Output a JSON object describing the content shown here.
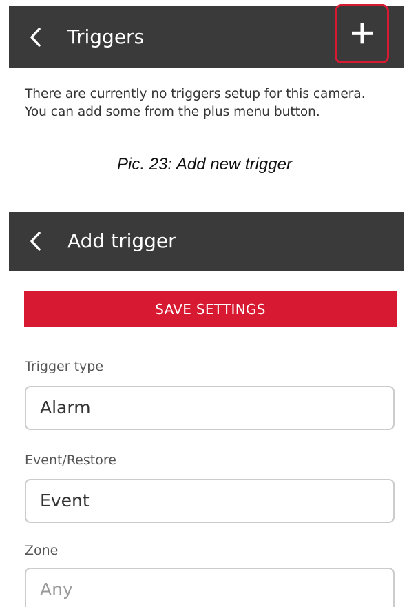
{
  "triggers_screen": {
    "title": "Triggers",
    "back_icon": "chevron-left-icon",
    "add_icon": "plus-icon",
    "highlight_color": "#d71a32",
    "empty_message_line1": "There are currently no triggers setup for this camera.",
    "empty_message_line2": "You can add some from the plus menu button."
  },
  "caption": "Pic. 23: Add new trigger",
  "add_trigger_screen": {
    "title": "Add trigger",
    "back_icon": "chevron-left-icon",
    "save_label": "SAVE SETTINGS",
    "fields": [
      {
        "label": "Trigger type",
        "value": "Alarm",
        "placeholder": ""
      },
      {
        "label": "Event/Restore",
        "value": "Event",
        "placeholder": ""
      },
      {
        "label": "Zone",
        "value": "",
        "placeholder": "Any"
      }
    ]
  },
  "colors": {
    "appbar_background": "#3a3a3a",
    "accent": "#d71a32",
    "input_border": "#cccccc"
  }
}
